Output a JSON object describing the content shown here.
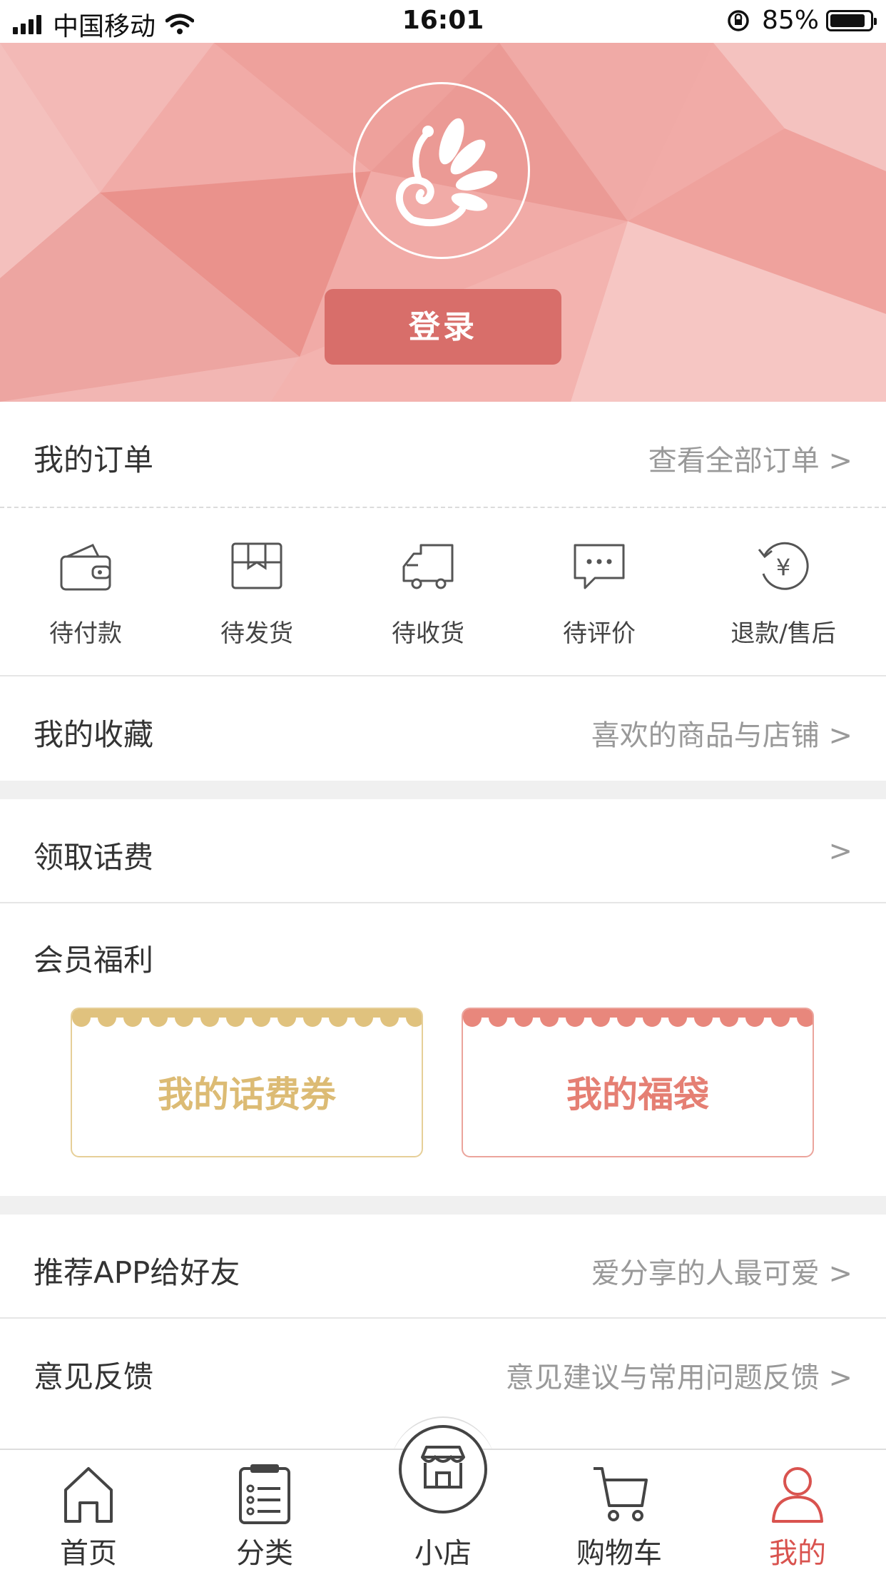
{
  "status_bar": {
    "carrier": "中国移动",
    "time": "16:01",
    "battery": "85%"
  },
  "header": {
    "login_label": "登录"
  },
  "orders": {
    "title": "我的订单",
    "view_all": "查看全部订单 >",
    "items": [
      {
        "label": "待付款",
        "icon": "wallet-icon"
      },
      {
        "label": "待发货",
        "icon": "box-icon"
      },
      {
        "label": "待收货",
        "icon": "truck-icon"
      },
      {
        "label": "待评价",
        "icon": "chat-icon"
      },
      {
        "label": "退款/售后",
        "icon": "refund-icon"
      }
    ]
  },
  "favorites": {
    "title": "我的收藏",
    "hint": "喜欢的商品与店铺 >"
  },
  "phone_credit": {
    "title": "领取话费",
    "hint": ">"
  },
  "member": {
    "title": "会员福利",
    "coupons": [
      {
        "label": "我的话费券",
        "color": "#e0c27e"
      },
      {
        "label": "我的福袋",
        "color": "#e8877c"
      }
    ]
  },
  "recommend": {
    "title": "推荐APP给好友",
    "hint": "爱分享的人最可爱 >"
  },
  "feedback": {
    "title": "意见反馈",
    "hint": "意见建议与常用问题反馈 >"
  },
  "tabbar": {
    "items": [
      {
        "label": "首页",
        "icon": "home-icon"
      },
      {
        "label": "分类",
        "icon": "list-icon"
      },
      {
        "label": "小店",
        "icon": "store-icon"
      },
      {
        "label": "购物车",
        "icon": "cart-icon"
      },
      {
        "label": "我的",
        "icon": "user-icon",
        "active": true
      }
    ],
    "active_color": "#d9534f"
  },
  "colors": {
    "accent": "#d86e6a",
    "hero_bg": "#f2b0ad"
  }
}
